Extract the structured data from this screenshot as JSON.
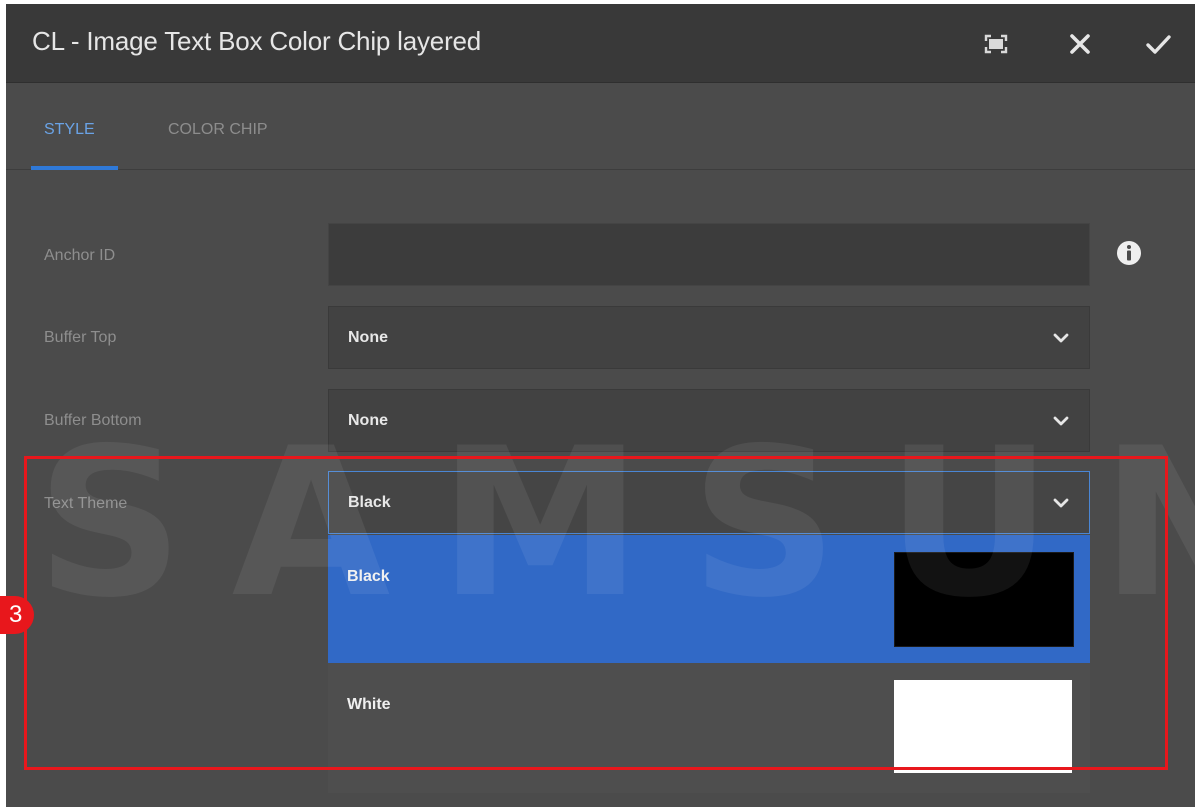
{
  "dialog": {
    "title": "CL - Image Text Box Color Chip layered",
    "actions": {
      "fullscreen_icon": "fullscreen-icon",
      "close_icon": "close-icon",
      "done_icon": "checkmark-icon"
    }
  },
  "tabs": [
    {
      "label": "STYLE",
      "active": true
    },
    {
      "label": "COLOR CHIP",
      "active": false
    }
  ],
  "form": {
    "anchor_id": {
      "label": "Anchor ID",
      "value": "",
      "info_icon": "info-icon"
    },
    "buffer_top": {
      "label": "Buffer Top",
      "value": "None"
    },
    "buffer_bottom": {
      "label": "Buffer Bottom",
      "value": "None"
    },
    "text_theme": {
      "label": "Text Theme",
      "value": "Black",
      "open": true,
      "options": [
        {
          "label": "Black",
          "chip_color": "#000000",
          "selected": true
        },
        {
          "label": "White",
          "chip_color": "#ffffff",
          "selected": false
        }
      ]
    }
  },
  "annotation": {
    "step_number": "3",
    "color": "#e8171c"
  },
  "watermark": "SAMSUNG",
  "colors": {
    "accent": "#2f79d8",
    "selected_option": "#3169c6",
    "dialog_bg": "#4b4b4b",
    "titlebar_bg": "#393939"
  }
}
